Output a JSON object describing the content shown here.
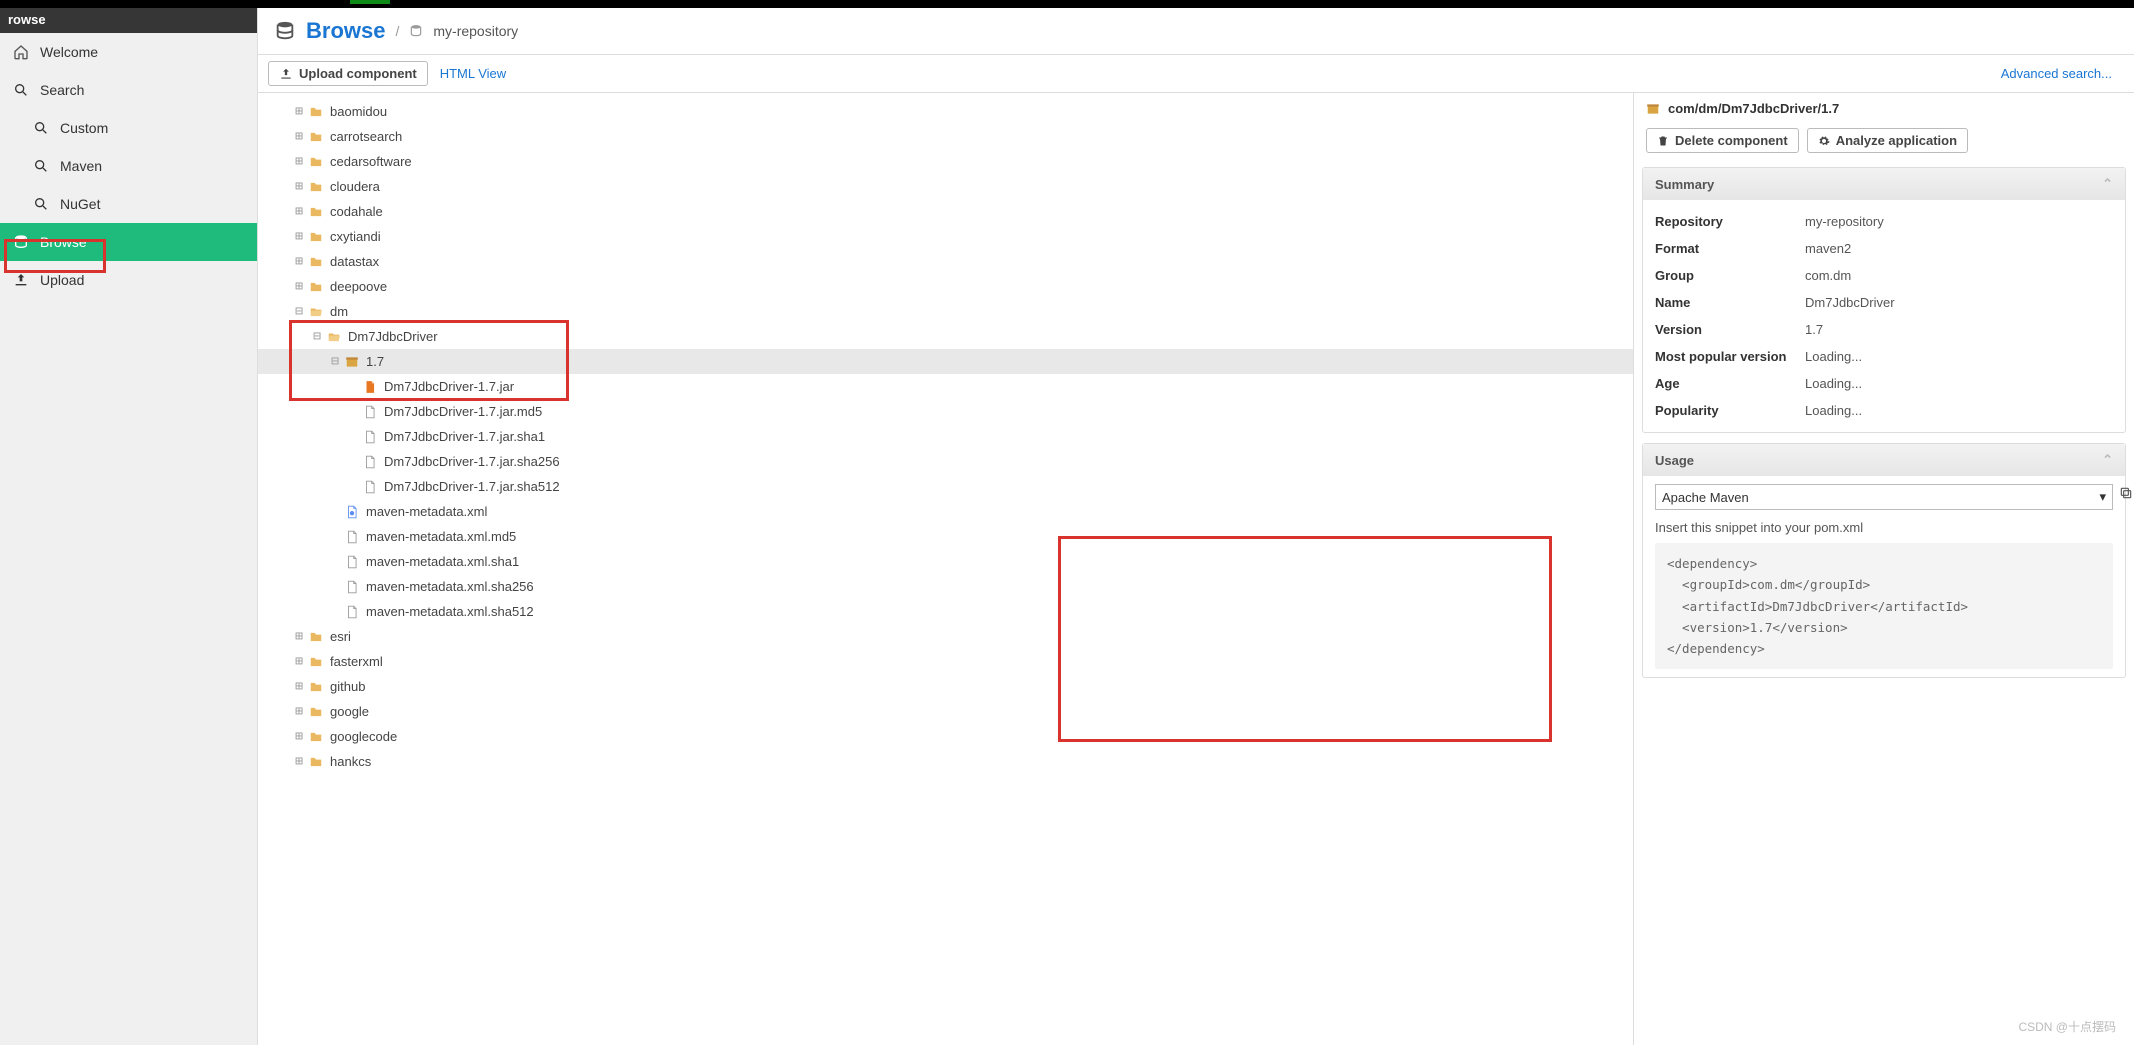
{
  "sidebar": {
    "top": "rowse",
    "items": [
      {
        "icon": "home",
        "label": "Welcome"
      },
      {
        "icon": "search",
        "label": "Search"
      },
      {
        "icon": "search",
        "label": "Custom",
        "child": true
      },
      {
        "icon": "search",
        "label": "Maven",
        "child": true
      },
      {
        "icon": "search",
        "label": "NuGet",
        "child": true
      },
      {
        "icon": "db",
        "label": "Browse",
        "active": true
      },
      {
        "icon": "upload",
        "label": "Upload"
      }
    ]
  },
  "breadcrumb": {
    "title": "Browse",
    "sep": "/",
    "repo": "my-repository"
  },
  "toolbar": {
    "upload": "Upload component",
    "html": "HTML View",
    "adv": "Advanced search..."
  },
  "tree": [
    {
      "d": 1,
      "e": "+",
      "i": "folder",
      "t": "baomidou"
    },
    {
      "d": 1,
      "e": "+",
      "i": "folder",
      "t": "carrotsearch"
    },
    {
      "d": 1,
      "e": "+",
      "i": "folder",
      "t": "cedarsoftware"
    },
    {
      "d": 1,
      "e": "+",
      "i": "folder",
      "t": "cloudera"
    },
    {
      "d": 1,
      "e": "+",
      "i": "folder",
      "t": "codahale"
    },
    {
      "d": 1,
      "e": "+",
      "i": "folder",
      "t": "cxytiandi"
    },
    {
      "d": 1,
      "e": "+",
      "i": "folder",
      "t": "datastax"
    },
    {
      "d": 1,
      "e": "+",
      "i": "folder",
      "t": "deepoove"
    },
    {
      "d": 1,
      "e": "-",
      "i": "folder-open",
      "t": "dm"
    },
    {
      "d": 2,
      "e": "-",
      "i": "folder-open",
      "t": "Dm7JdbcDriver"
    },
    {
      "d": 3,
      "e": "-",
      "i": "arch",
      "t": "1.7",
      "sel": true
    },
    {
      "d": 4,
      "e": " ",
      "i": "jar",
      "t": "Dm7JdbcDriver-1.7.jar"
    },
    {
      "d": 4,
      "e": " ",
      "i": "file",
      "t": "Dm7JdbcDriver-1.7.jar.md5"
    },
    {
      "d": 4,
      "e": " ",
      "i": "file",
      "t": "Dm7JdbcDriver-1.7.jar.sha1"
    },
    {
      "d": 4,
      "e": " ",
      "i": "file",
      "t": "Dm7JdbcDriver-1.7.jar.sha256"
    },
    {
      "d": 4,
      "e": " ",
      "i": "file",
      "t": "Dm7JdbcDriver-1.7.jar.sha512"
    },
    {
      "d": 3,
      "e": " ",
      "i": "xml",
      "t": "maven-metadata.xml"
    },
    {
      "d": 3,
      "e": " ",
      "i": "file",
      "t": "maven-metadata.xml.md5"
    },
    {
      "d": 3,
      "e": " ",
      "i": "file",
      "t": "maven-metadata.xml.sha1"
    },
    {
      "d": 3,
      "e": " ",
      "i": "file",
      "t": "maven-metadata.xml.sha256"
    },
    {
      "d": 3,
      "e": " ",
      "i": "file",
      "t": "maven-metadata.xml.sha512"
    },
    {
      "d": 1,
      "e": "+",
      "i": "folder",
      "t": "esri"
    },
    {
      "d": 1,
      "e": "+",
      "i": "folder",
      "t": "fasterxml"
    },
    {
      "d": 1,
      "e": "+",
      "i": "folder",
      "t": "github"
    },
    {
      "d": 1,
      "e": "+",
      "i": "folder",
      "t": "google"
    },
    {
      "d": 1,
      "e": "+",
      "i": "folder",
      "t": "googlecode"
    },
    {
      "d": 1,
      "e": "+",
      "i": "folder",
      "t": "hankcs"
    }
  ],
  "detail": {
    "path": "com/dm/Dm7JdbcDriver/1.7",
    "delete": "Delete component",
    "analyze": "Analyze application",
    "summaryTitle": "Summary",
    "summary": [
      {
        "k": "Repository",
        "v": "my-repository"
      },
      {
        "k": "Format",
        "v": "maven2"
      },
      {
        "k": "Group",
        "v": "com.dm"
      },
      {
        "k": "Name",
        "v": "Dm7JdbcDriver"
      },
      {
        "k": "Version",
        "v": "1.7"
      },
      {
        "k": "Most popular version",
        "v": "Loading..."
      },
      {
        "k": "Age",
        "v": "Loading..."
      },
      {
        "k": "Popularity",
        "v": "Loading..."
      }
    ],
    "usageTitle": "Usage",
    "usageSelect": "Apache Maven",
    "usageHint": "Insert this snippet into your pom.xml",
    "usageCode": "<dependency>\n  <groupId>com.dm</groupId>\n  <artifactId>Dm7JdbcDriver</artifactId>\n  <version>1.7</version>\n</dependency>"
  },
  "watermark": "CSDN @十点摆码"
}
